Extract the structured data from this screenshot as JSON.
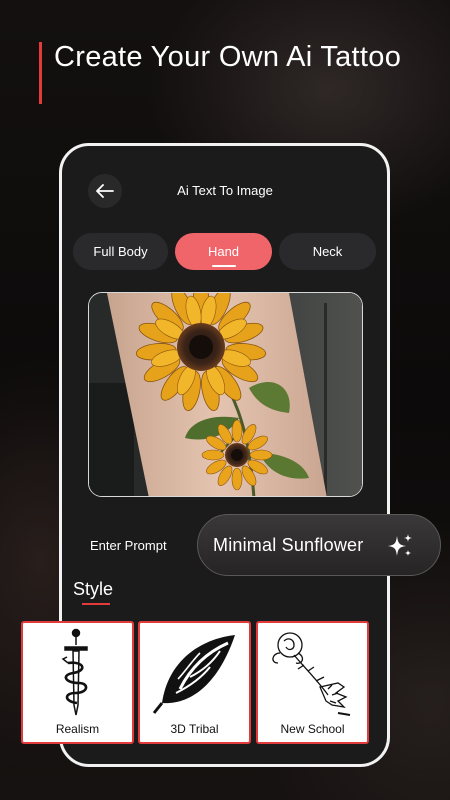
{
  "headline": "Create Your Own Ai Tattoo",
  "screen": {
    "title": "Ai Text To Image",
    "back_icon": "arrow-left-icon"
  },
  "tabs": [
    {
      "label": "Full Body",
      "active": false
    },
    {
      "label": "Hand",
      "active": true
    },
    {
      "label": "Neck",
      "active": false
    }
  ],
  "preview_image": "sunflower-forearm-tattoo",
  "prompt": {
    "label": "Enter Prompt",
    "value": "Minimal Sunflower",
    "icon": "sparkle-icon"
  },
  "style": {
    "title": "Style",
    "items": [
      {
        "label": "Realism",
        "image": "dagger-snake-tattoo"
      },
      {
        "label": "3D Tribal",
        "image": "tribal-leaf-tattoo"
      },
      {
        "label": "New School",
        "image": "skeleton-hand-rose-tattoo"
      }
    ]
  },
  "colors": {
    "accent": "#e23b3b",
    "active_tab": "#f0656a",
    "phone_bg": "#1c1b1c"
  }
}
